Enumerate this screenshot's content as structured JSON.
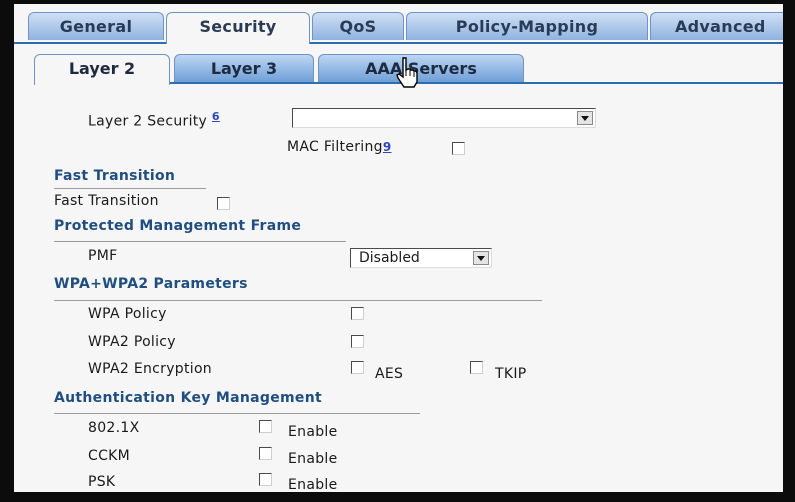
{
  "top_tabs": [
    "General",
    "Security",
    "QoS",
    "Policy-Mapping",
    "Advanced"
  ],
  "sub_tabs": [
    "Layer 2",
    "Layer 3",
    "AAA Servers"
  ],
  "layer2": {
    "security_label": "Layer 2 Security",
    "security_help": "6",
    "security_value": "",
    "mac_label": "MAC Filtering",
    "mac_help": "9"
  },
  "fast_transition": {
    "heading": "Fast Transition",
    "label": "Fast Transition"
  },
  "pmf": {
    "heading": "Protected Management Frame",
    "label": "PMF",
    "value": "Disabled"
  },
  "wpa": {
    "heading": "WPA+WPA2 Parameters",
    "policy": "WPA Policy",
    "policy2": "WPA2 Policy",
    "encryption": "WPA2 Encryption",
    "aes": "AES",
    "tkip": "TKIP"
  },
  "akm": {
    "heading": "Authentication Key Management",
    "rows": [
      {
        "label": "802.1X",
        "option": "Enable"
      },
      {
        "label": "CCKM",
        "option": "Enable"
      },
      {
        "label": "PSK",
        "option": "Enable"
      }
    ]
  },
  "colors": {
    "accent": "#2a6fb0",
    "section_text": "#1f4e85",
    "tab_gradient_top": "#cfe0f6",
    "tab_gradient_bottom": "#8fb3df"
  }
}
